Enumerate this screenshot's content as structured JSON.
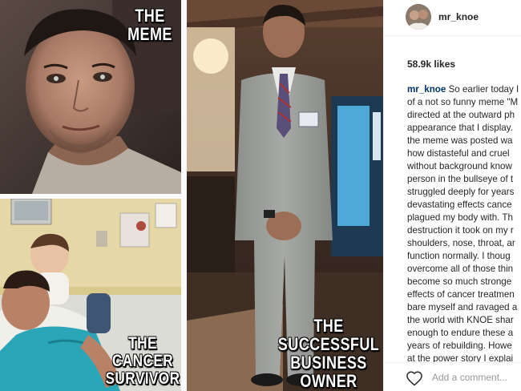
{
  "collage": {
    "meme_caption": [
      "THE",
      "MEME"
    ],
    "cancer_caption": [
      "THE",
      "CANCER",
      "SURVIVOR"
    ],
    "business_caption": [
      "THE",
      "SUCCESSFUL",
      "BUSINESS",
      "OWNER"
    ]
  },
  "post": {
    "username": "mr_knoe",
    "likes": "58.9k likes",
    "caption_user": "mr_knoe",
    "caption_lines": [
      "So earlier today I saw",
      "of a not so funny meme \"M",
      "directed at the outward ph",
      "appearance that I display.",
      "the meme was posted wa",
      "how distasteful and cruel",
      "without background know",
      "person in the bullseye of t",
      "struggled deeply for years",
      "devastating effects cance",
      "plagued my body with. Th",
      "destruction it took on my r",
      "shoulders, nose, throat, ar",
      "function normally. I thoug",
      "overcome all of those thin",
      "become so much stronge",
      "effects of cancer treatmen",
      "bare myself and ravaged a",
      "the world with KNOE shar",
      "enough to endure these a",
      "years of rebuilding. Howe",
      "at the power story I explai"
    ],
    "comment_placeholder": "Add a comment..."
  }
}
